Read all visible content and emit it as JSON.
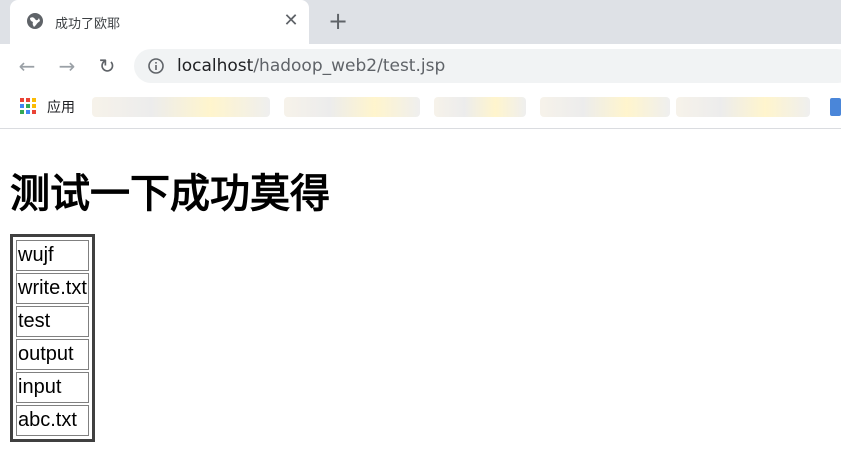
{
  "tab": {
    "title": "成功了欧耶",
    "close_symbol": "✕",
    "new_tab_symbol": "+"
  },
  "toolbar": {
    "back_symbol": "←",
    "forward_symbol": "→",
    "reload_symbol": "↻",
    "url_host": "localhost",
    "url_path": "/hadoop_web2/test.jsp"
  },
  "bookmarks": {
    "apps_label": "应用"
  },
  "page": {
    "heading": "测试一下成功莫得",
    "files": [
      "wujf",
      "write.txt",
      "test",
      "output",
      "input",
      "abc.txt"
    ]
  }
}
